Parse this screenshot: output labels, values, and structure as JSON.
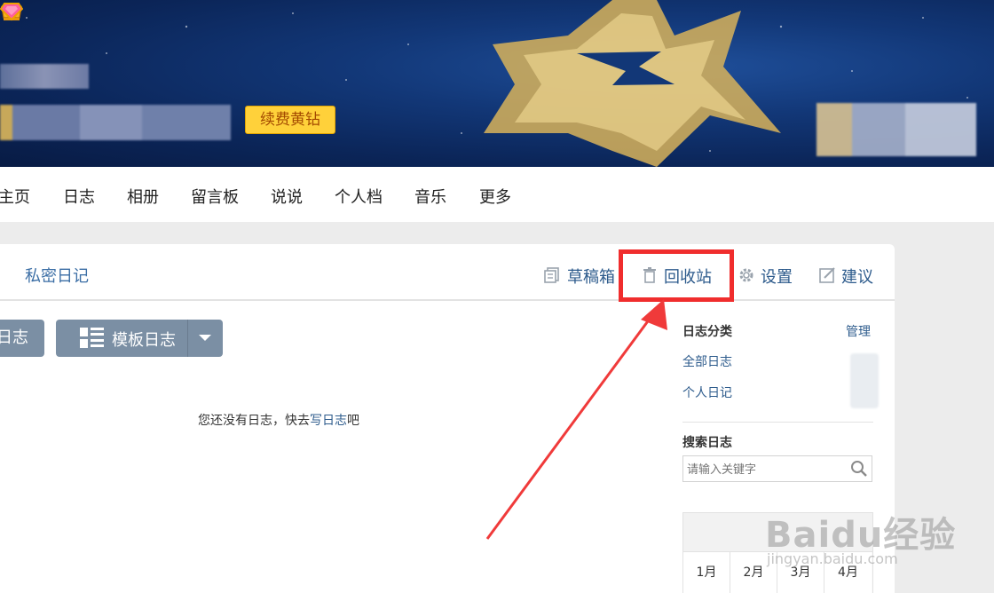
{
  "banner": {
    "vip_button": "续费黄钻",
    "crown_icon": "crown-icon",
    "diamond_icon": "diamond-icon"
  },
  "nav": {
    "items": [
      "主页",
      "日志",
      "相册",
      "留言板",
      "说说",
      "个人档",
      "音乐",
      "更多"
    ]
  },
  "blog": {
    "tab_private": "私密日记",
    "toolbar": {
      "drafts": "草稿箱",
      "recycle": "回收站",
      "settings": "设置",
      "suggest": "建议"
    },
    "write_button_partial": "日志",
    "template_button": "模板日志",
    "empty_text": "您还没有日志，快去",
    "empty_link": "写日志",
    "empty_suffix": "吧"
  },
  "sidebar": {
    "category_title": "日志分类",
    "manage": "管理",
    "categories": [
      "全部日志",
      "个人日记"
    ],
    "search_title": "搜索日志",
    "search_placeholder": "请输入关键字",
    "months": [
      "1月",
      "2月",
      "3月",
      "4月"
    ]
  },
  "watermark": {
    "brand": "Baidu经验",
    "url": "jingyan.baidu.com"
  },
  "colors": {
    "link": "#2d5b8c",
    "highlight_box": "#f02d2d",
    "vip_yellow": "#ffd13a"
  }
}
